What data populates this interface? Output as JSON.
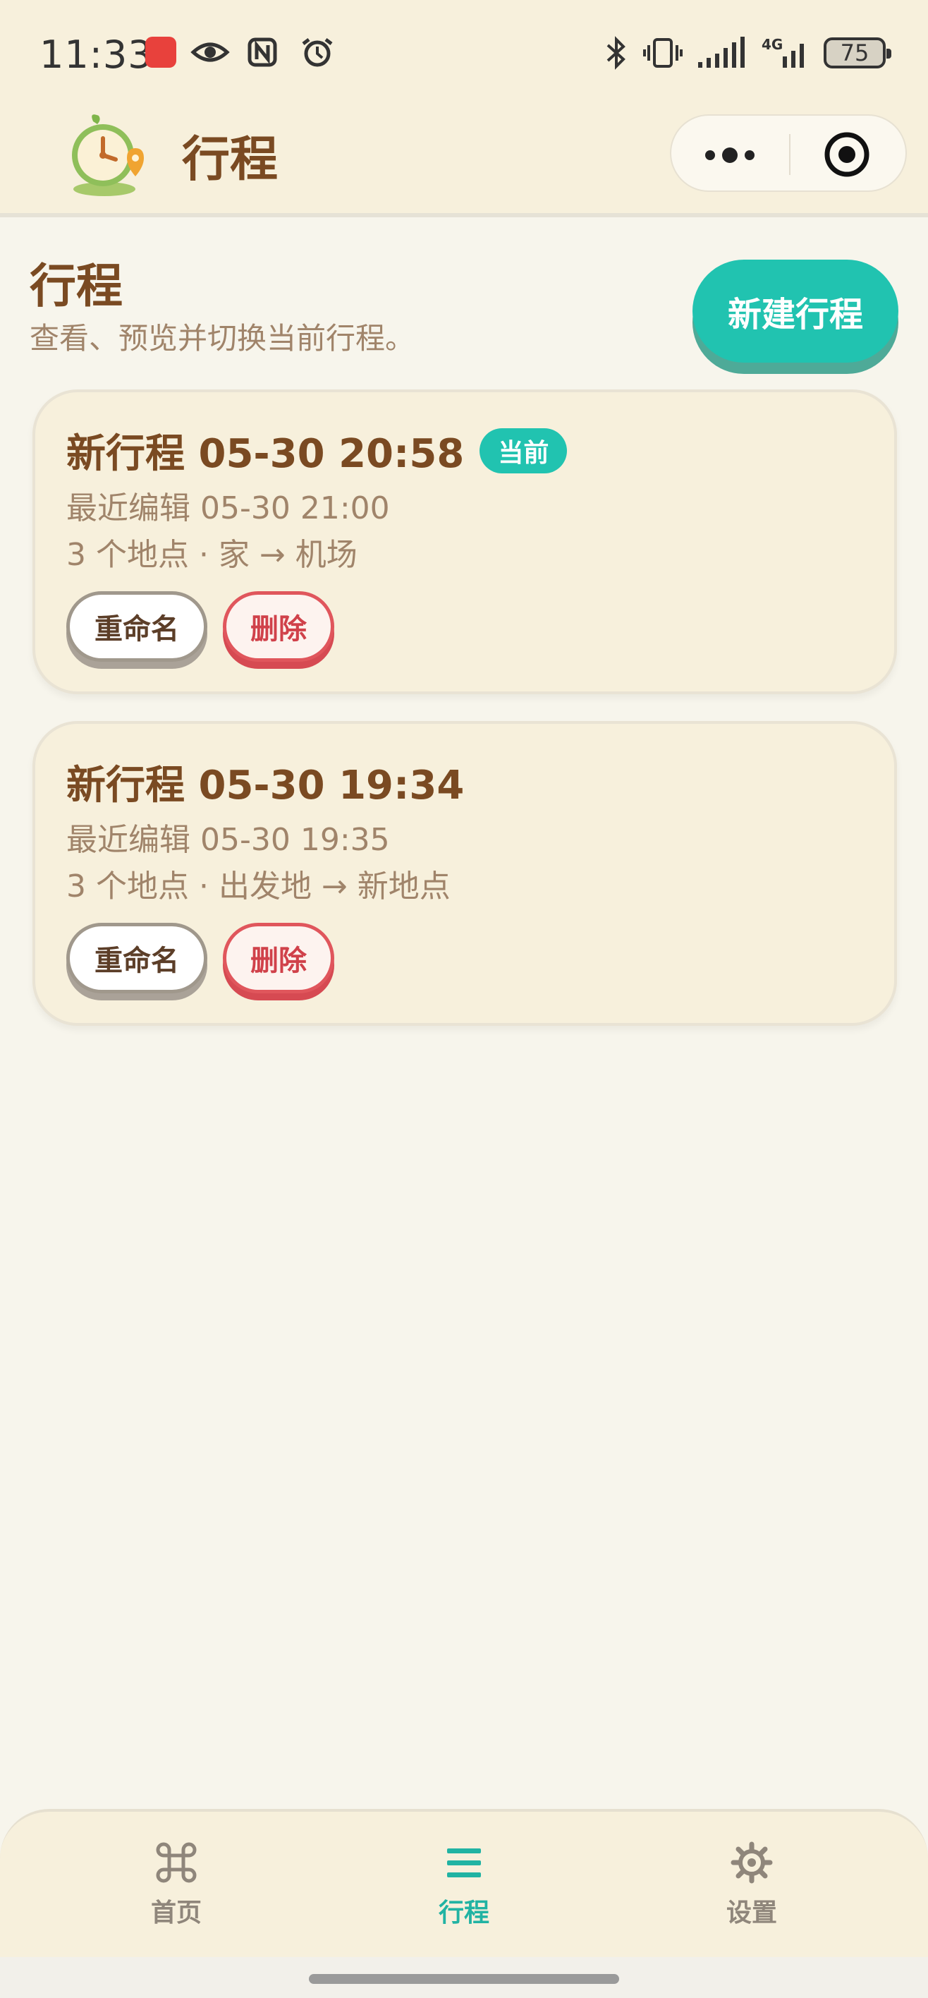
{
  "status_bar": {
    "time": "11:33",
    "battery": "75",
    "network": "4G",
    "icons": [
      "huawei-app-icon",
      "eye-icon",
      "nfc-icon",
      "alarm-icon",
      "bluetooth-icon",
      "vibrate-icon",
      "signal-icon"
    ]
  },
  "header": {
    "title": "行程",
    "logo": "clock-pin-logo",
    "capsule": {
      "more_icon": "more-dots-icon",
      "close_icon": "target-icon"
    }
  },
  "page": {
    "title": "行程",
    "subtitle": "查看、预览并切换当前行程。",
    "new_trip_label": "新建行程"
  },
  "trips": [
    {
      "name": "新行程 05-30 20:58",
      "badge": "当前",
      "edited": "最近编辑 05-30 21:00",
      "summary": "3 个地点 · 家 → 机场",
      "rename_label": "重命名",
      "delete_label": "删除"
    },
    {
      "name": "新行程 05-30 19:34",
      "edited": "最近编辑 05-30 19:35",
      "summary": "3 个地点 · 出发地 → 新地点",
      "rename_label": "重命名",
      "delete_label": "删除"
    }
  ],
  "tab_bar": {
    "tabs": [
      {
        "label": "首页",
        "icon": "command-icon",
        "active": false
      },
      {
        "label": "行程",
        "icon": "list-icon",
        "active": true
      },
      {
        "label": "设置",
        "icon": "gear-icon",
        "active": false
      }
    ]
  },
  "colors": {
    "accent": "#21c3b0",
    "brown_text": "#7a4a22",
    "muted_text": "#a0846a",
    "danger": "#d0414a",
    "card_bg": "#f7f0dc",
    "page_bg": "#f7f5ec"
  }
}
